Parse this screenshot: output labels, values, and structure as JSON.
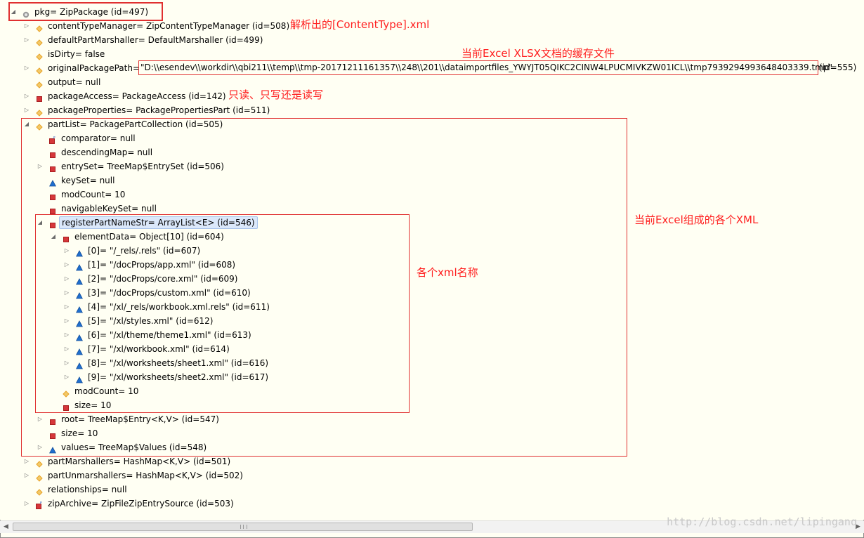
{
  "rows": [
    {
      "indent": 0,
      "twisty": "expanded",
      "icon": "info-icon",
      "label": "pkg= ZipPackage  (id=497)"
    },
    {
      "indent": 1,
      "twisty": "collapsed",
      "icon": "diamond-icon",
      "label": "contentTypeManager= ZipContentTypeManager  (id=508)"
    },
    {
      "indent": 1,
      "twisty": "collapsed",
      "icon": "diamond-icon",
      "label": "defaultPartMarshaller= DefaultMarshaller  (id=499)"
    },
    {
      "indent": 1,
      "twisty": "none",
      "icon": "diamond-icon",
      "label": "isDirty= false"
    },
    {
      "indent": 1,
      "twisty": "collapsed",
      "icon": "diamond-icon",
      "label": "originalPackagePath= "
    },
    {
      "indent": 1,
      "twisty": "none",
      "icon": "diamond-icon",
      "label": "output= null"
    },
    {
      "indent": 1,
      "twisty": "collapsed",
      "icon": "private-field-icon",
      "label": "packageAccess= PackageAccess  (id=142)"
    },
    {
      "indent": 1,
      "twisty": "collapsed",
      "icon": "diamond-icon",
      "label": "packageProperties= PackagePropertiesPart  (id=511)"
    },
    {
      "indent": 1,
      "twisty": "expanded",
      "icon": "diamond-icon",
      "label": "partList= PackagePartCollection  (id=505)"
    },
    {
      "indent": 2,
      "twisty": "none",
      "icon": "private-final-field-icon",
      "label": "comparator= null"
    },
    {
      "indent": 2,
      "twisty": "none",
      "icon": "private-field-icon",
      "label": "descendingMap= null"
    },
    {
      "indent": 2,
      "twisty": "collapsed",
      "icon": "private-field-icon",
      "label": "entrySet= TreeMap$EntrySet  (id=506)"
    },
    {
      "indent": 2,
      "twisty": "none",
      "icon": "default-field-icon",
      "label": "keySet= null"
    },
    {
      "indent": 2,
      "twisty": "none",
      "icon": "private-field-icon",
      "label": "modCount= 10"
    },
    {
      "indent": 2,
      "twisty": "none",
      "icon": "private-field-icon",
      "label": "navigableKeySet= null"
    },
    {
      "indent": 2,
      "twisty": "expanded",
      "icon": "private-field-icon",
      "label": "registerPartNameStr= ArrayList<E>  (id=546)",
      "selected": true
    },
    {
      "indent": 3,
      "twisty": "expanded",
      "icon": "private-field-icon",
      "label": "elementData= Object[10]  (id=604)"
    },
    {
      "indent": 4,
      "twisty": "collapsed",
      "icon": "default-field-icon",
      "label": "[0]= \"/_rels/.rels\"  (id=607)"
    },
    {
      "indent": 4,
      "twisty": "collapsed",
      "icon": "default-field-icon",
      "label": "[1]= \"/docProps/app.xml\"  (id=608)"
    },
    {
      "indent": 4,
      "twisty": "collapsed",
      "icon": "default-field-icon",
      "label": "[2]= \"/docProps/core.xml\"  (id=609)"
    },
    {
      "indent": 4,
      "twisty": "collapsed",
      "icon": "default-field-icon",
      "label": "[3]= \"/docProps/custom.xml\"  (id=610)"
    },
    {
      "indent": 4,
      "twisty": "collapsed",
      "icon": "default-field-icon",
      "label": "[4]= \"/xl/_rels/workbook.xml.rels\"  (id=611)"
    },
    {
      "indent": 4,
      "twisty": "collapsed",
      "icon": "default-field-icon",
      "label": "[5]= \"/xl/styles.xml\"  (id=612)"
    },
    {
      "indent": 4,
      "twisty": "collapsed",
      "icon": "default-field-icon",
      "label": "[6]= \"/xl/theme/theme1.xml\"  (id=613)"
    },
    {
      "indent": 4,
      "twisty": "collapsed",
      "icon": "default-field-icon",
      "label": "[7]= \"/xl/workbook.xml\"  (id=614)"
    },
    {
      "indent": 4,
      "twisty": "collapsed",
      "icon": "default-field-icon",
      "label": "[8]= \"/xl/worksheets/sheet1.xml\"  (id=616)"
    },
    {
      "indent": 4,
      "twisty": "collapsed",
      "icon": "default-field-icon",
      "label": "[9]= \"/xl/worksheets/sheet2.xml\"  (id=617)"
    },
    {
      "indent": 3,
      "twisty": "none",
      "icon": "diamond-icon",
      "label": "modCount= 10"
    },
    {
      "indent": 3,
      "twisty": "none",
      "icon": "private-field-icon",
      "label": "size= 10"
    },
    {
      "indent": 2,
      "twisty": "collapsed",
      "icon": "private-field-icon",
      "label": "root= TreeMap$Entry<K,V>  (id=547)"
    },
    {
      "indent": 2,
      "twisty": "none",
      "icon": "private-field-icon",
      "label": "size= 10"
    },
    {
      "indent": 2,
      "twisty": "collapsed",
      "icon": "default-field-icon",
      "label": "values= TreeMap$Values  (id=548)"
    },
    {
      "indent": 1,
      "twisty": "collapsed",
      "icon": "diamond-icon",
      "label": "partMarshallers= HashMap<K,V>  (id=501)"
    },
    {
      "indent": 1,
      "twisty": "collapsed",
      "icon": "diamond-icon",
      "label": "partUnmarshallers= HashMap<K,V>  (id=502)"
    },
    {
      "indent": 1,
      "twisty": "none",
      "icon": "diamond-icon",
      "label": "relationships= null"
    },
    {
      "indent": 1,
      "twisty": "collapsed",
      "icon": "private-final-field-icon",
      "label": "zipArchive= ZipFileZipEntrySource  (id=503)"
    }
  ],
  "original_path": {
    "value": "\"D:\\\\esendev\\\\workdir\\\\qbi211\\\\temp\\\\tmp-20171211161357\\\\248\\\\201\\\\dataimportfiles_YWYJT05QIKC2CINW4LPUCMIVKZW01ICL\\\\tmp7939294993648403339.tmp\"",
    "id": "(id=555)"
  },
  "annotations": {
    "content_type": "解析出的[ContentType].xml",
    "cache_file": "当前Excel XLSX文档的缓存文件",
    "access": "只读、只写还是读写",
    "xml_parts": "当前Excel组成的各个XML",
    "xml_names": "各个xml名称"
  },
  "colors": {
    "annotation": "#ff2020",
    "background": "#fffff3",
    "selection": "#dbe8fa",
    "private_icon": "#d6373a",
    "default_icon": "#1f6fcf",
    "protected_icon": "#e8a227"
  },
  "watermark": "http://blog.csdn.net/lipinganq"
}
